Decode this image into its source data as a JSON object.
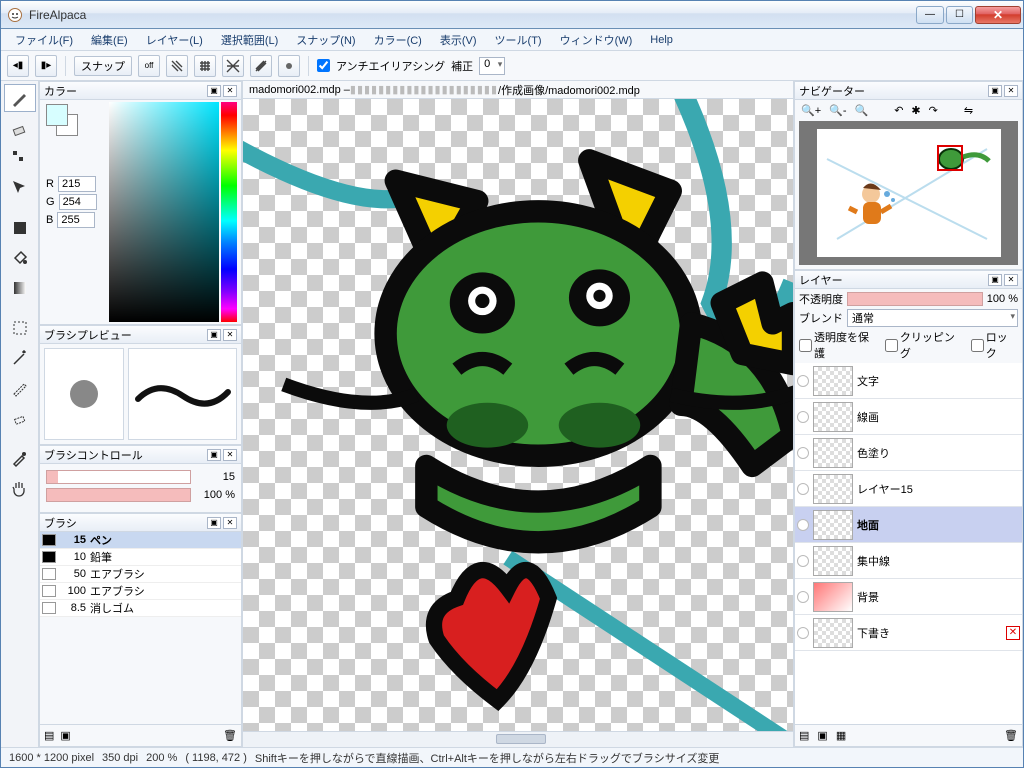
{
  "window": {
    "title": "FireAlpaca"
  },
  "menu": {
    "file": "ファイル(F)",
    "edit": "編集(E)",
    "layer": "レイヤー(L)",
    "select": "選択範囲(L)",
    "snap": "スナップ(N)",
    "color": "カラー(C)",
    "view": "表示(V)",
    "tool": "ツール(T)",
    "window": "ウィンドウ(W)",
    "help": "Help"
  },
  "optbar": {
    "snap": "スナップ",
    "off": "off",
    "aa_label": "アンチエイリアシング",
    "hosei_label": "補正",
    "hosei_value": "0"
  },
  "doc_tab": {
    "left": "madomori002.mdp – ",
    "right": "/作成画像/madomori002.mdp"
  },
  "panels": {
    "color": "カラー",
    "brush_preview": "ブラシプレビュー",
    "brush_control": "ブラシコントロール",
    "brush": "ブラシ",
    "navigator": "ナビゲーター",
    "layer": "レイヤー"
  },
  "color": {
    "r_label": "R",
    "g_label": "G",
    "b_label": "B",
    "r": "215",
    "g": "254",
    "b": "255"
  },
  "brush_control": {
    "size": "15",
    "opacity": "100 %"
  },
  "brushes": [
    {
      "size": "15",
      "name": "ペン",
      "sel": true,
      "black": true
    },
    {
      "size": "10",
      "name": "鉛筆",
      "black": true
    },
    {
      "size": "50",
      "name": "エアブラシ"
    },
    {
      "size": "100",
      "name": "エアブラシ"
    },
    {
      "size": "8.5",
      "name": "消しゴム"
    }
  ],
  "layer_panel": {
    "opacity_label": "不透明度",
    "opacity_value": "100 %",
    "blend_label": "ブレンド",
    "blend_value": "通常",
    "protect": "透明度を保護",
    "clipping": "クリッピング",
    "lock": "ロック"
  },
  "layers": [
    {
      "name": "文字"
    },
    {
      "name": "線画"
    },
    {
      "name": "色塗り"
    },
    {
      "name": "レイヤー15"
    },
    {
      "name": "地面",
      "sel": true
    },
    {
      "name": "集中線"
    },
    {
      "name": "背景"
    },
    {
      "name": "下書き"
    }
  ],
  "status": {
    "dim": "1600 * 1200 pixel",
    "dpi": "350 dpi",
    "zoom": "200 %",
    "coord": "( 1198, 472 )",
    "hint": "Shiftキーを押しながらで直線描画、Ctrl+Altキーを押しながら左右ドラッグでブラシサイズ変更"
  }
}
